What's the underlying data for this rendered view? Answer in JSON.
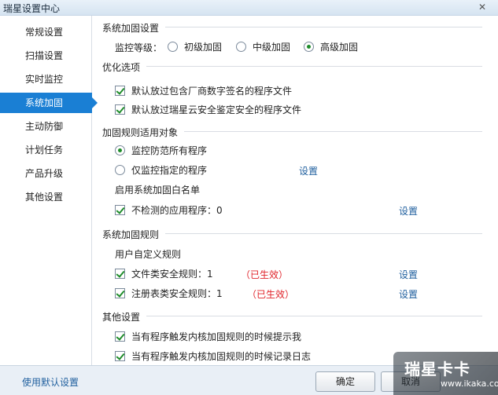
{
  "window": {
    "title": "瑞星设置中心",
    "close_glyph": "✕"
  },
  "sidebar": {
    "items": [
      {
        "label": "常规设置"
      },
      {
        "label": "扫描设置"
      },
      {
        "label": "实时监控"
      },
      {
        "label": "系统加固",
        "active": true
      },
      {
        "label": "主动防御"
      },
      {
        "label": "计划任务"
      },
      {
        "label": "产品升级"
      },
      {
        "label": "其他设置"
      }
    ]
  },
  "sections": {
    "hardening": {
      "title": "系统加固设置",
      "level_label": "监控等级：",
      "levels": [
        "初级加固",
        "中级加固",
        "高级加固"
      ],
      "selected_level": "高级加固"
    },
    "optimize": {
      "title": "优化选项",
      "options": [
        "默认放过包含厂商数字签名的程序文件",
        "默认放过瑞星云安全鉴定安全的程序文件"
      ]
    },
    "scope": {
      "title": "加固规则适用对象",
      "options": [
        "监控防范所有程序",
        "仅监控指定的程序"
      ],
      "selected": "监控防范所有程序",
      "settings_link": "设置",
      "whitelist_title": "启用系统加固白名单",
      "whitelist_item": "不检测的应用程序：0",
      "whitelist_link": "设置"
    },
    "rules": {
      "title": "系统加固规则",
      "custom_title": "用户自定义规则",
      "items": [
        {
          "label": "文件类安全规则：1",
          "status": "（已生效）",
          "link": "设置"
        },
        {
          "label": "注册表类安全规则：1",
          "status": "（已生效）",
          "link": "设置"
        }
      ]
    },
    "other": {
      "title": "其他设置",
      "options": [
        "当有程序触发内核加固规则的时候提示我",
        "当有程序触发内核加固规则的时候记录日志"
      ]
    }
  },
  "footer": {
    "default_link": "使用默认设置",
    "ok": "确定",
    "cancel": "取消"
  },
  "watermark": {
    "text": "瑞星卡卡",
    "url": "www.ikaka.com"
  },
  "colors": {
    "accent": "#1a7fd4",
    "link": "#1f5f9e",
    "status_red": "#e0242b",
    "check_green": "#1e8c2a"
  }
}
